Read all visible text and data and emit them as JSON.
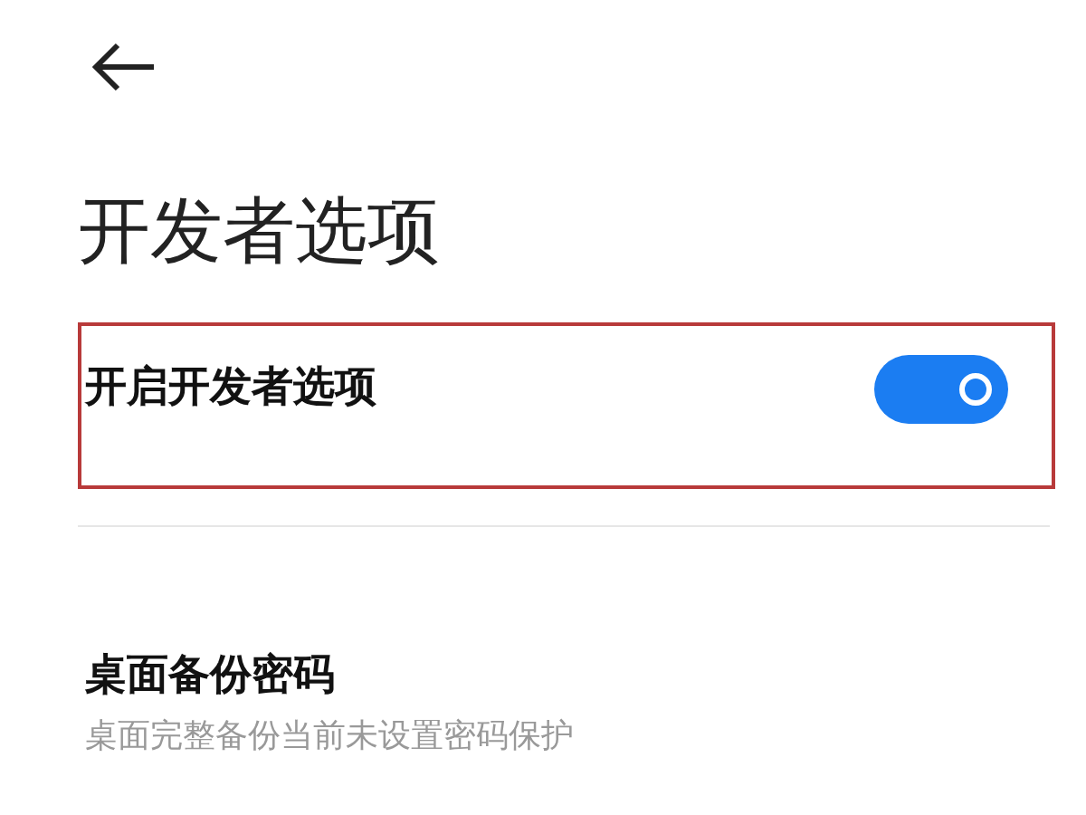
{
  "title": "开发者选项",
  "settings": [
    {
      "kind": "toggle",
      "label": "开启开发者选项",
      "on": true,
      "highlighted": true
    },
    {
      "kind": "text",
      "label": "桌面备份密码",
      "description": "桌面完整备份当前未设置密码保护",
      "highlighted": false
    }
  ]
}
